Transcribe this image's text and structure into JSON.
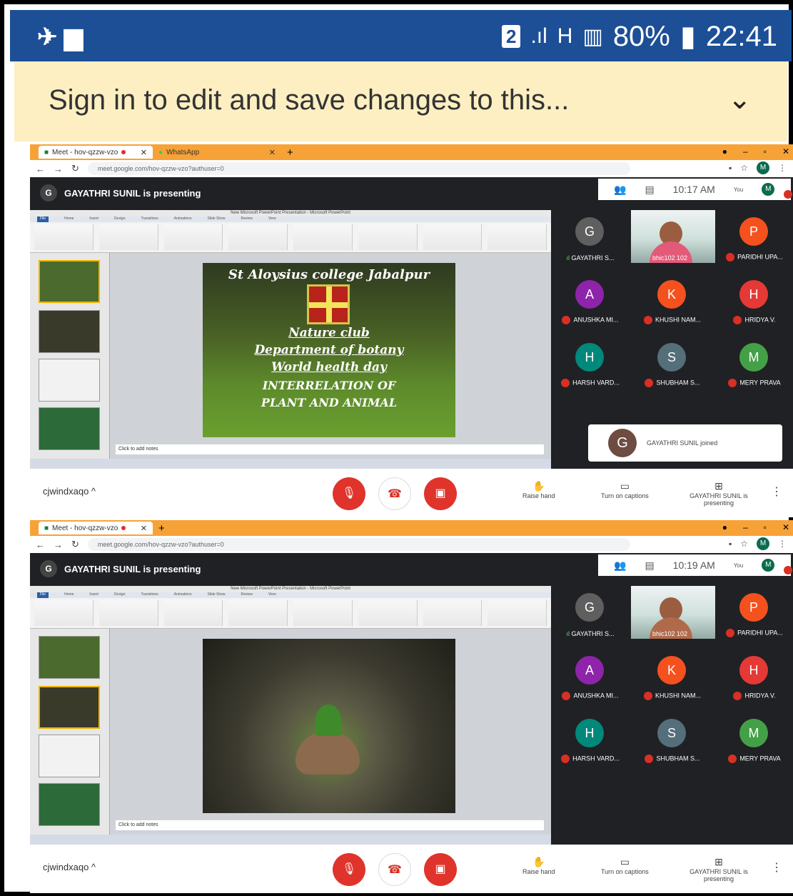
{
  "statusbar": {
    "left_icons": "✈ ▆",
    "sim": "2",
    "signal": ".ıl",
    "h": "H",
    "signal2": "▥",
    "battery": "80%",
    "time": "22:41"
  },
  "banner": {
    "text": "Sign in to edit and save changes to this...",
    "chevron": "⌄"
  },
  "browser": {
    "tab1": "Meet - hov-qzzw-vzo",
    "tab2": "WhatsApp",
    "url": "meet.google.com/hov-qzzw-vzo?authuser=0"
  },
  "meeting": {
    "presenter_initial": "G",
    "presenting_text": "GAYATHRI SUNIL is presenting",
    "times": [
      "10:17 AM",
      "10:19 AM"
    ],
    "you": "You",
    "me_initial": "M",
    "code": "cjwindxaqo ^",
    "controls": {
      "raise_hand": "Raise hand",
      "captions": "Turn on captions",
      "presenting": "GAYATHRI SUNIL is presenting"
    },
    "toast": "GAYATHRI SUNIL joined",
    "participants": [
      {
        "initial": "G",
        "name": "GAYATHRI S...",
        "color": "#5f5f5f"
      },
      {
        "initial": "",
        "name": "bhic102 102",
        "color": ""
      },
      {
        "initial": "P",
        "name": "PARIDHI UPA...",
        "color": "#f4511e"
      },
      {
        "initial": "A",
        "name": "ANUSHKA MI...",
        "color": "#8e24aa"
      },
      {
        "initial": "K",
        "name": "KHUSHI NAM...",
        "color": "#f4511e"
      },
      {
        "initial": "H",
        "name": "HRIDYA V.",
        "color": "#e53935"
      },
      {
        "initial": "H",
        "name": "HARSH VARD...",
        "color": "#00897b"
      },
      {
        "initial": "S",
        "name": "SHUBHAM S...",
        "color": "#546e7a"
      },
      {
        "initial": "M",
        "name": "MERY PRAVA",
        "color": "#43a047"
      }
    ]
  },
  "slide": {
    "college": "St Aloysius college Jabalpur",
    "club": "Nature club",
    "dept": "Department of botany",
    "day": "World health day",
    "line1": "INTERRELATION OF",
    "line2": "PLANT AND ANIMAL",
    "notes": "Click to add notes"
  },
  "ppt": {
    "title": "New Microsoft PowerPoint Presentation - Microsoft PowerPoint",
    "file": "File",
    "tabs": [
      "Home",
      "Insert",
      "Design",
      "Transitions",
      "Animations",
      "Slide Show",
      "Review",
      "View"
    ]
  }
}
